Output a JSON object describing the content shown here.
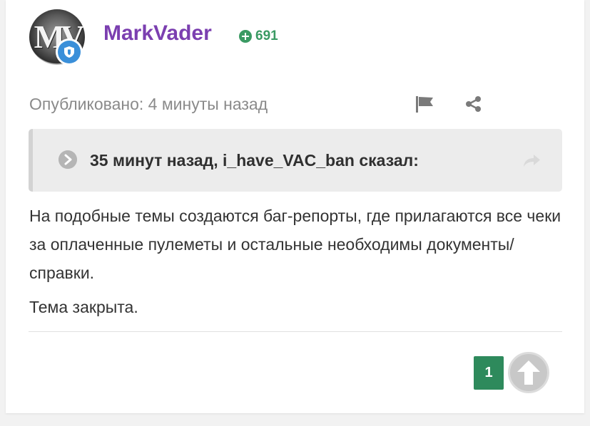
{
  "author": {
    "avatar_monogram": "MV",
    "badge_icon": "shield-icon",
    "username": "MarkVader",
    "reputation": "691",
    "reputation_icon": "plus-circle-icon"
  },
  "post": {
    "posted_label": "Опубликовано: 4 минуты назад",
    "actions": {
      "report_icon": "flag-icon",
      "share_icon": "share-icon"
    },
    "quote": {
      "header": "35 минут назад, i_have_VAC_ban сказал:",
      "expand_icon": "chevron-right-circle-icon",
      "goto_icon": "reply-arrow-icon"
    },
    "paragraphs": [
      "На подобные темы создаются баг-репорты, где прилагаются все чеки за оплаченные пулеметы и остальные необходимы документы/справки.",
      "Тема закрыта."
    ],
    "reaction_count": "1",
    "reaction_icon": "arrow-up-icon"
  },
  "colors": {
    "username": "#7b3fb0",
    "reputation": "#3a9a63",
    "reaction_count_bg": "#2e8a5c",
    "badge": "#3a8fd9"
  }
}
